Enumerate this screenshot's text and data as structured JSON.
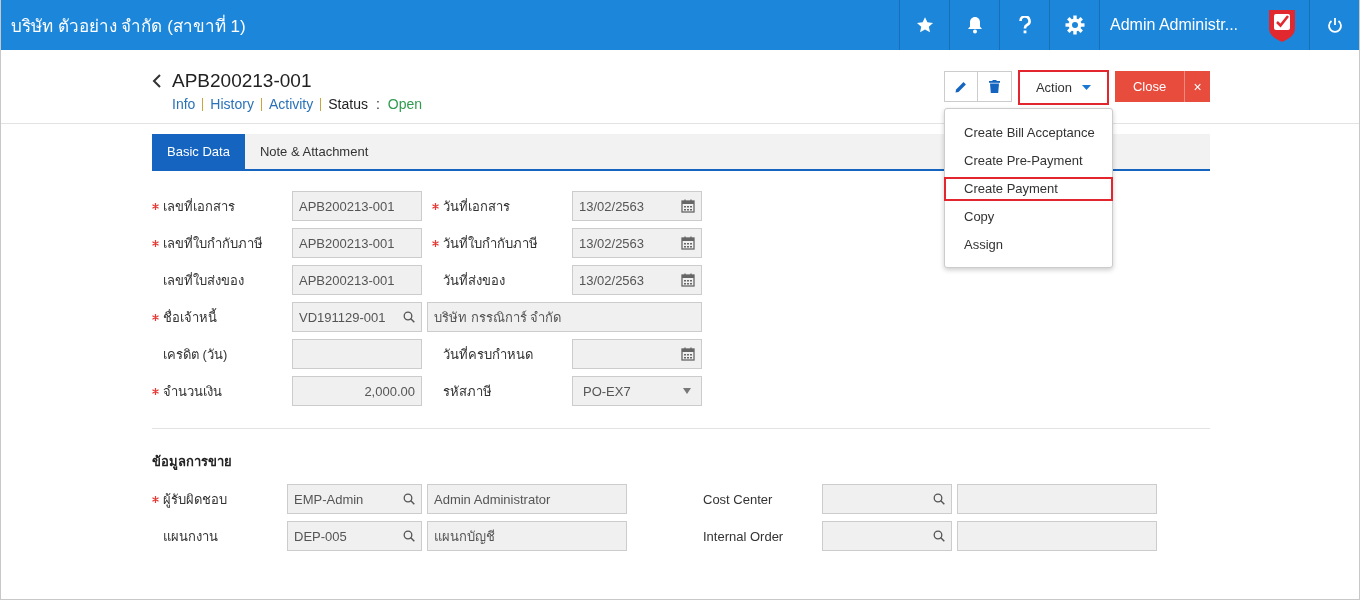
{
  "app": {
    "title": "บริษัท ตัวอย่าง จำกัด (สาขาที่ 1)",
    "user": "Admin Administr..."
  },
  "document": {
    "number": "APB200213-001",
    "links": [
      {
        "label": "Info"
      },
      {
        "label": "History"
      },
      {
        "label": "Activity"
      }
    ],
    "status": {
      "label": "Status",
      "separator": ":",
      "value": "Open"
    }
  },
  "toolbar": {
    "action": {
      "label": "Action",
      "highlighted": true
    },
    "close": {
      "label": "Close",
      "dismiss": "×"
    }
  },
  "action_menu": [
    {
      "label": "Create Bill Acceptance",
      "highlighted": false
    },
    {
      "label": "Create Pre-Payment",
      "highlighted": false
    },
    {
      "label": "Create Payment",
      "highlighted": true
    },
    {
      "label": "Copy",
      "highlighted": false
    },
    {
      "label": "Assign",
      "highlighted": false
    }
  ],
  "tabs": [
    {
      "label": "Basic Data",
      "selected": true
    },
    {
      "label": "Note & Attachment",
      "selected": false
    }
  ],
  "basic_data": [
    [
      {
        "kind": "label",
        "text": "เลขที่เอกสาร",
        "required": true
      },
      {
        "kind": "text",
        "value": "APB200213-001"
      },
      {
        "kind": "label",
        "text": "วันที่เอกสาร",
        "required": true
      },
      {
        "kind": "date",
        "value": "13/02/2563"
      }
    ],
    [
      {
        "kind": "label",
        "text": "เลขที่ใบกำกับภาษี",
        "required": true
      },
      {
        "kind": "text",
        "value": "APB200213-001"
      },
      {
        "kind": "label",
        "text": "วันที่ใบกำกับภาษี",
        "required": true
      },
      {
        "kind": "date",
        "value": "13/02/2563"
      }
    ],
    [
      {
        "kind": "label",
        "text": "เลขที่ใบส่งของ",
        "required": false
      },
      {
        "kind": "text",
        "value": "APB200213-001"
      },
      {
        "kind": "label",
        "text": "วันที่ส่งของ",
        "required": false
      },
      {
        "kind": "date",
        "value": "13/02/2563"
      }
    ],
    [
      {
        "kind": "label",
        "text": "ชื่อเจ้าหนี้",
        "required": true
      },
      {
        "kind": "lookup",
        "value": "VD191129-001"
      },
      {
        "kind": "name",
        "value": "บริษัท กรรณิการ์ จำกัด"
      }
    ],
    [
      {
        "kind": "label",
        "text": "เครดิต (วัน)",
        "required": false
      },
      {
        "kind": "text"
      },
      {
        "kind": "label",
        "text": "วันที่ครบกำหนด",
        "required": false
      },
      {
        "kind": "date"
      }
    ],
    [
      {
        "kind": "label",
        "text": "จำนวนเงิน",
        "required": true
      },
      {
        "kind": "amount",
        "value": "2,000.00"
      },
      {
        "kind": "label",
        "text": "รหัสภาษี",
        "required": false
      },
      {
        "kind": "select",
        "value": "PO-EX7"
      }
    ]
  ],
  "sales": {
    "title": "ข้อมูลการขาย",
    "rows": [
      [
        {
          "kind": "label",
          "text": "ผู้รับผิดชอบ",
          "required": true
        },
        {
          "kind": "lookup",
          "value": "EMP-Admin"
        },
        {
          "kind": "name",
          "value": "Admin Administrator"
        },
        {
          "kind": "label",
          "text": "Cost Center",
          "required": false
        },
        {
          "kind": "lookup"
        },
        {
          "kind": "name"
        }
      ],
      [
        {
          "kind": "label",
          "text": "แผนกงาน",
          "required": false
        },
        {
          "kind": "lookup",
          "value": "DEP-005"
        },
        {
          "kind": "name",
          "value": "แผนกบัญชี"
        },
        {
          "kind": "label",
          "text": "Internal Order",
          "required": false
        },
        {
          "kind": "lookup"
        },
        {
          "kind": "name"
        }
      ]
    ]
  }
}
